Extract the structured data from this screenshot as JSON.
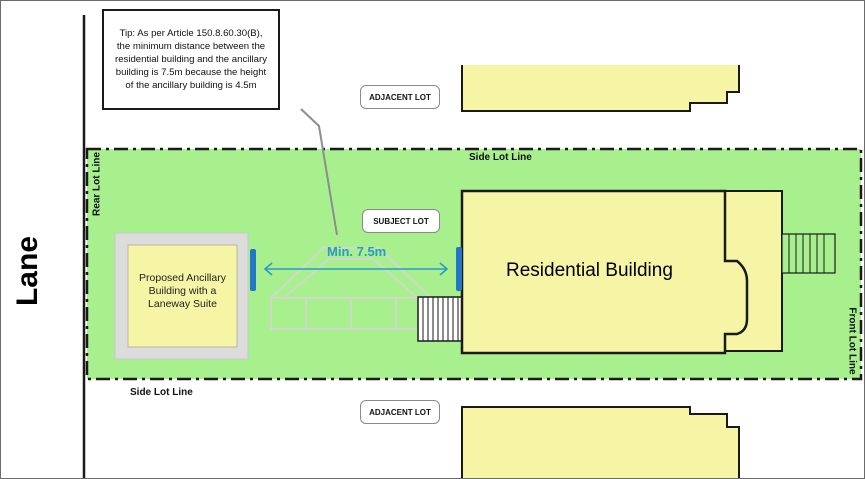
{
  "lane": {
    "label": "Lane"
  },
  "lot_lines": {
    "rear": "Rear Lot Line",
    "front": "Front Lot Line",
    "side_top": "Side Lot Line",
    "side_bottom": "Side Lot Line"
  },
  "lots": {
    "adjacent_top": "ADJACENT LOT",
    "subject": "SUBJECT LOT",
    "adjacent_bottom": "ADJACENT LOT"
  },
  "tip": {
    "lines": [
      "Tip: As per Article 150.8.60.30(B),",
      "the minimum distance between the",
      "residential building and the ancillary",
      "building is 7.5m because the height",
      "of the ancillary building is 4.5m"
    ]
  },
  "ancillary": {
    "lines": [
      "Proposed Ancillary",
      "Building with a",
      "Laneway Suite"
    ]
  },
  "residential": {
    "label": "Residential Building"
  },
  "distance": {
    "label": "Min. 7.5m"
  },
  "colors": {
    "lot_fill": "#a8f08e",
    "building_fill": "#f6f5a6",
    "separation_marker": "#2277c6",
    "distance_text": "#2b9ac6",
    "outline": "#1a1a1a"
  }
}
